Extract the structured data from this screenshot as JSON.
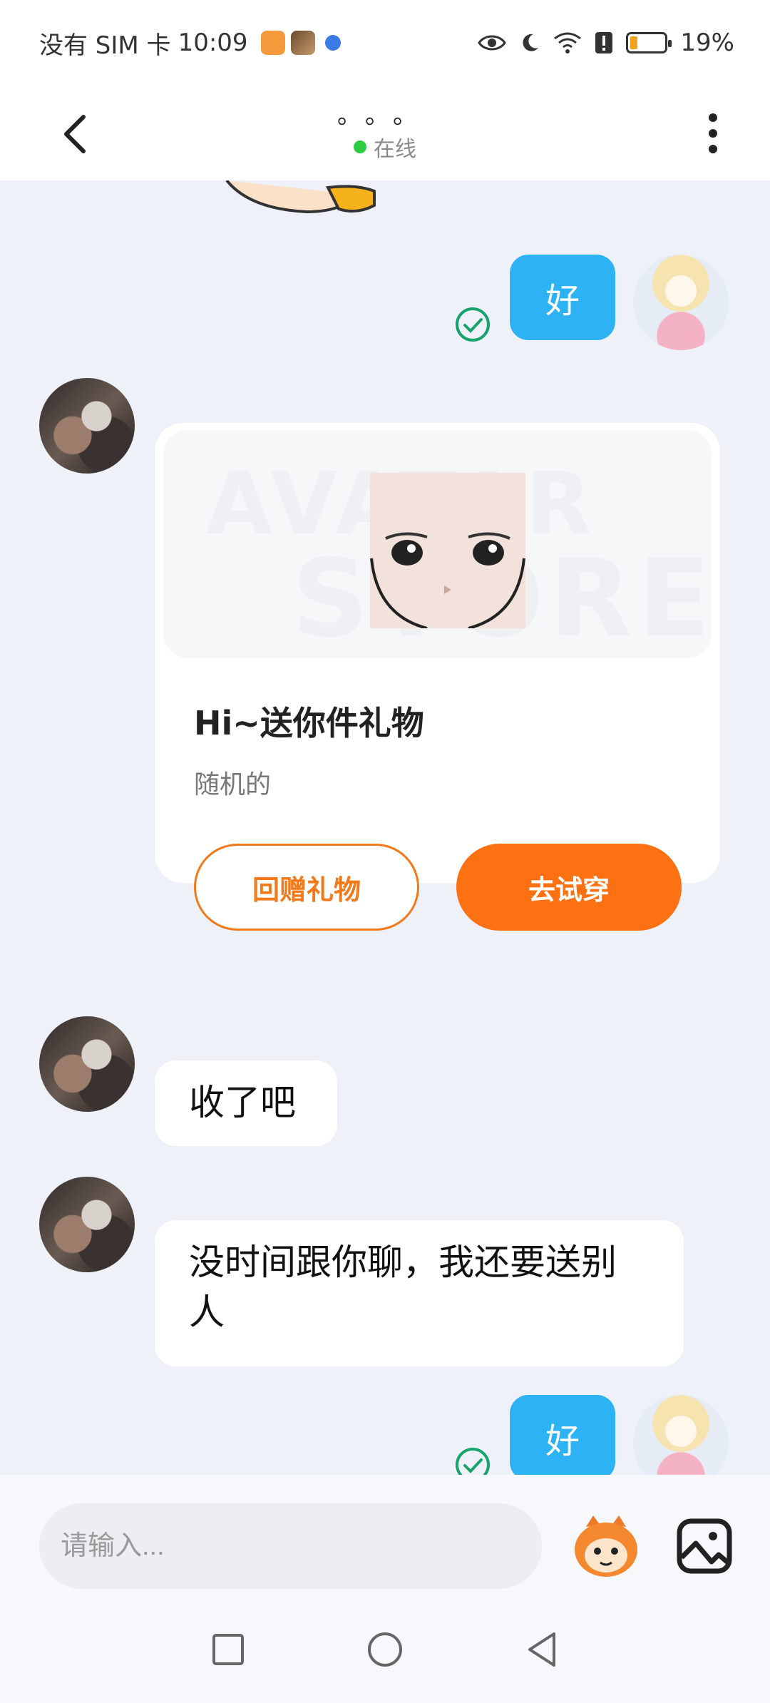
{
  "status_bar": {
    "carrier": "没有 SIM 卡",
    "time": "10:09",
    "battery": "19%",
    "battery_level": 0.19
  },
  "header": {
    "title": "。。。",
    "status": "在线"
  },
  "messages": [
    {
      "side": "out",
      "text": "好",
      "read": true
    },
    {
      "type": "gift",
      "title": "Hi~送你件礼物",
      "subtitle": "随机的",
      "left_button": "回赠礼物",
      "right_button": "去试穿"
    },
    {
      "side": "in",
      "text": "收了吧"
    },
    {
      "side": "in",
      "text": "没时间跟你聊，我还要送别人"
    },
    {
      "side": "out",
      "text": "好",
      "read": true
    }
  ],
  "gift_watermark": {
    "line1": "AVATAR",
    "line2": "STORE"
  },
  "input": {
    "placeholder": "请输入..."
  },
  "colors": {
    "accent_orange": "#fd7113",
    "bubble_blue": "#2db3f4",
    "online_green": "#2ecc40",
    "check_green": "#17a36b"
  }
}
